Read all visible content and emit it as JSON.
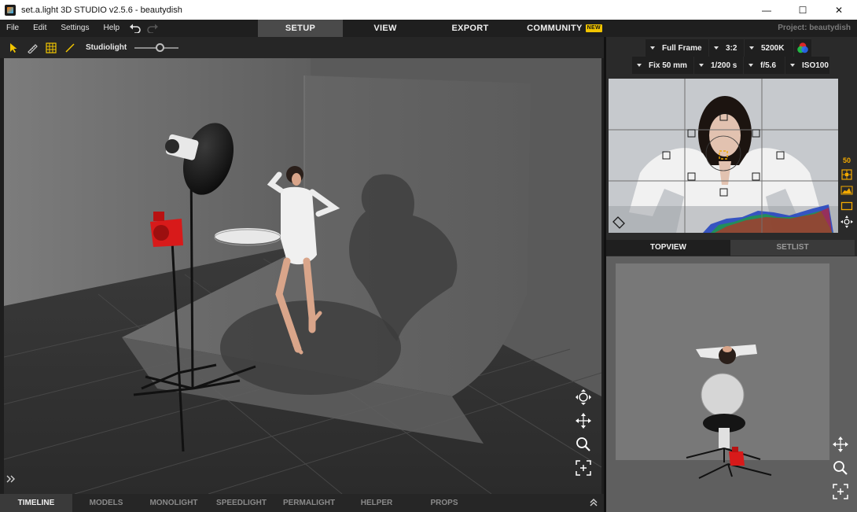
{
  "window": {
    "title": "set.a.light 3D STUDIO v2.5.6 - beautydish",
    "controls": {
      "minimize": "—",
      "maximize": "☐",
      "close": "✕"
    }
  },
  "menu": {
    "items": [
      "File",
      "Edit",
      "Settings",
      "Help"
    ],
    "icons": [
      "undo-icon",
      "redo-icon"
    ]
  },
  "nav": {
    "tabs": [
      "SETUP",
      "VIEW",
      "EXPORT",
      "COMMUNITY"
    ],
    "active": "SETUP",
    "badge": "NEW",
    "project": "Project: beautydish"
  },
  "toolbar": {
    "tools": [
      "pointer-icon",
      "measure-icon",
      "grid-icon",
      "line-icon"
    ],
    "slider_label": "Studiolight",
    "slider_value": 0.6
  },
  "camera": {
    "sensor": "Full Frame",
    "ratio": "3:2",
    "white_balance": "5200K",
    "lens": "Fix 50 mm",
    "shutter": "1/200 s",
    "aperture": "f/5.6",
    "iso": "ISO100"
  },
  "preview": {
    "zoom_label": "50",
    "side_icons": [
      "focus-grid-icon",
      "histogram-icon",
      "frame-icon",
      "navigate-icon"
    ]
  },
  "right_tabs": [
    "TOPVIEW",
    "SETLIST"
  ],
  "right_active": "TOPVIEW",
  "bottom_tabs": [
    "TIMELINE",
    "MODELS",
    "MONOLIGHT",
    "SPEEDLIGHT",
    "PERMALIGHT",
    "HELPER",
    "PROPS"
  ],
  "bottom_active": "TIMELINE",
  "viewport_controls": [
    "orbit-icon",
    "pan-icon",
    "zoom-icon",
    "fit-icon"
  ],
  "topview_controls": [
    "pan-icon",
    "zoom-icon",
    "fit-icon"
  ],
  "colors": {
    "accent": "#f2c500",
    "active_tab": "#4a4a4a",
    "bar": "#1f1f1f",
    "light_red": "#d81a1a"
  }
}
